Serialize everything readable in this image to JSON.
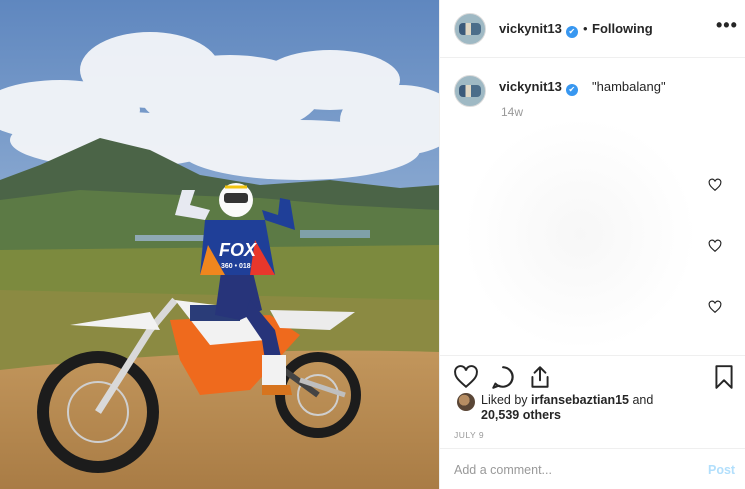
{
  "post": {
    "username": "vickynit13",
    "verified_mark": "✔",
    "separator": "•",
    "follow_status": "Following",
    "more_label": "•••"
  },
  "caption": {
    "username": "vickynit13",
    "text": "\"hambalang\"",
    "time": "14w"
  },
  "photo": {
    "jersey_brand": "FOX",
    "jersey_number": "360 • 018"
  },
  "likes": {
    "prefix": "Liked by ",
    "user": "irfansebaztian15",
    "joiner": " and",
    "count": "20,539 others"
  },
  "date": "JULY 9",
  "comment_box": {
    "placeholder": "Add a comment...",
    "post_label": "Post"
  },
  "colors": {
    "accent": "#3897f0",
    "post_disabled": "#b2dffc",
    "muted_text": "#999999"
  },
  "icons": [
    "heart-icon",
    "comment-icon",
    "share-icon",
    "bookmark-icon",
    "more-icon",
    "verified-badge-icon"
  ]
}
